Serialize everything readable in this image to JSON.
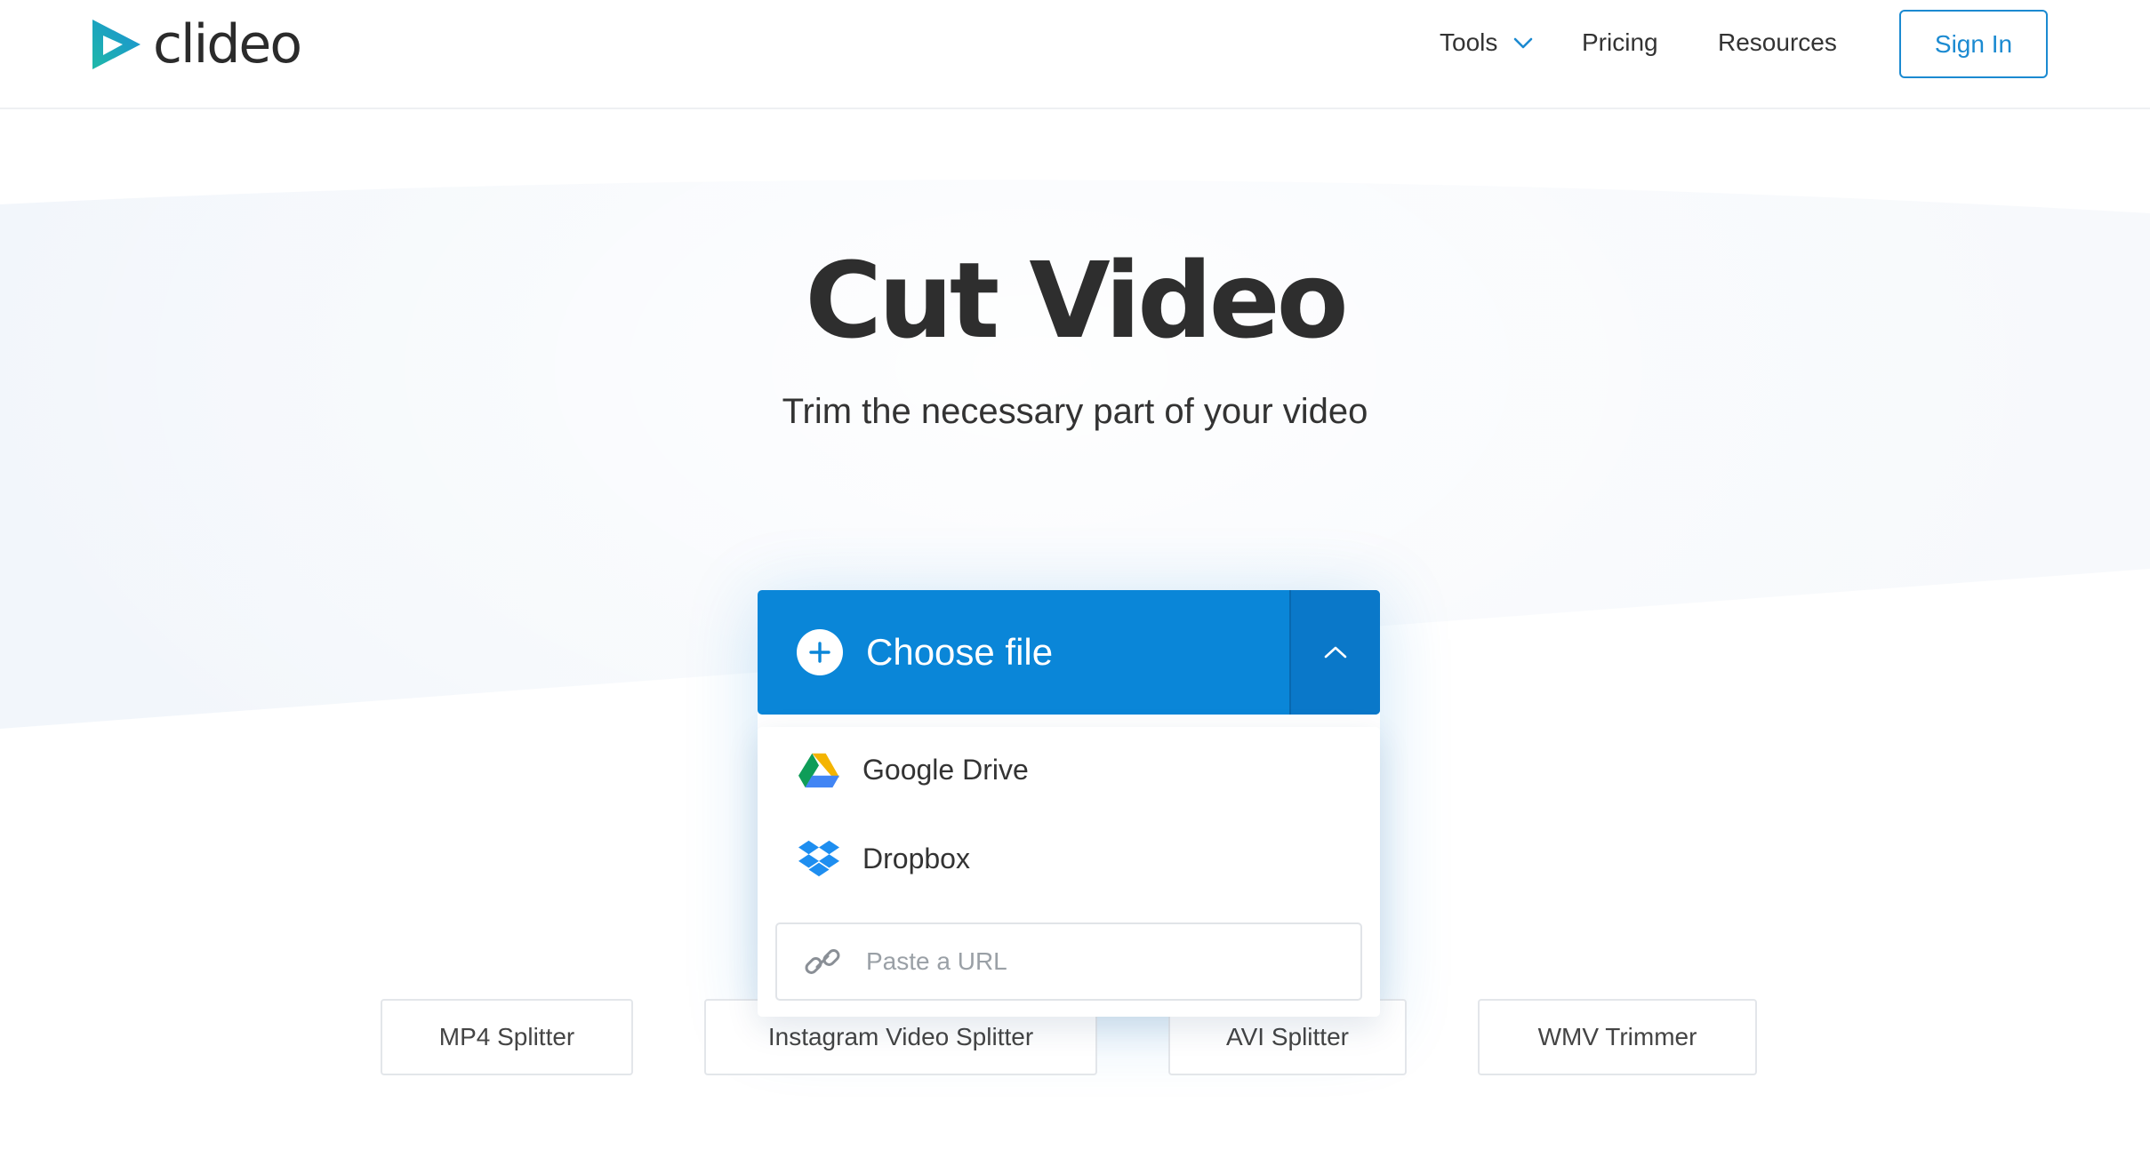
{
  "header": {
    "logo_text": "clideo",
    "nav": {
      "tools_label": "Tools",
      "pricing_label": "Pricing",
      "resources_label": "Resources"
    },
    "signin_label": "Sign In"
  },
  "hero": {
    "title": "Cut Video",
    "subtitle": "Trim the necessary part of your video"
  },
  "upload": {
    "choose_label": "Choose file",
    "dropdown": {
      "google_drive_label": "Google Drive",
      "dropbox_label": "Dropbox",
      "url_placeholder": "Paste a URL"
    }
  },
  "related_tools": [
    "MP4 Splitter",
    "Instagram Video Splitter",
    "AVI Splitter",
    "WMV Trimmer"
  ],
  "colors": {
    "accent": "#0a86d8",
    "accent_dark": "#0a78c9",
    "signin_border": "#1b8ad1",
    "logo_teal": "#1fb9a8",
    "logo_blue": "#1a8fd6"
  }
}
